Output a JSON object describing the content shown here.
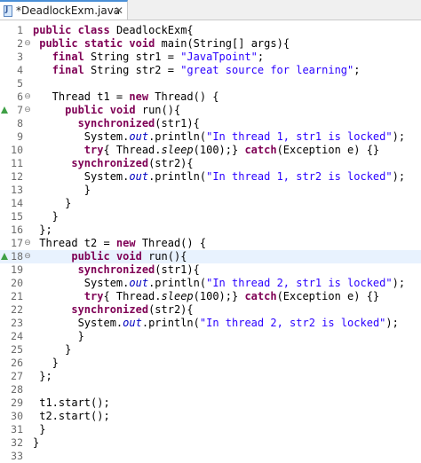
{
  "tab": {
    "title": "*DeadlockExm.java",
    "close_glyph": "✕"
  },
  "fold_glyphs": {
    "expanded": "⊖"
  },
  "lines": [
    {
      "n": "1",
      "segs": [
        {
          "t": "kw",
          "v": "public"
        },
        {
          "t": "p",
          "v": " "
        },
        {
          "t": "kw",
          "v": "class"
        },
        {
          "t": "p",
          "v": " DeadlockExm{"
        }
      ]
    },
    {
      "n": "2",
      "fold": true,
      "segs": [
        {
          "t": "p",
          "v": " "
        },
        {
          "t": "kw",
          "v": "public"
        },
        {
          "t": "p",
          "v": " "
        },
        {
          "t": "kw",
          "v": "static"
        },
        {
          "t": "p",
          "v": " "
        },
        {
          "t": "kw",
          "v": "void"
        },
        {
          "t": "p",
          "v": " main(String[] args){"
        }
      ]
    },
    {
      "n": "3",
      "segs": [
        {
          "t": "p",
          "v": "   "
        },
        {
          "t": "kw",
          "v": "final"
        },
        {
          "t": "p",
          "v": " String str1 = "
        },
        {
          "t": "str",
          "v": "\"JavaTpoint\""
        },
        {
          "t": "p",
          "v": ";"
        }
      ]
    },
    {
      "n": "4",
      "segs": [
        {
          "t": "p",
          "v": "   "
        },
        {
          "t": "kw",
          "v": "final"
        },
        {
          "t": "p",
          "v": " String str2 = "
        },
        {
          "t": "str",
          "v": "\"great source for learning\""
        },
        {
          "t": "p",
          "v": ";"
        }
      ]
    },
    {
      "n": "5",
      "segs": []
    },
    {
      "n": "6",
      "fold": true,
      "segs": [
        {
          "t": "p",
          "v": "   Thread t1 = "
        },
        {
          "t": "kw",
          "v": "new"
        },
        {
          "t": "p",
          "v": " Thread() {"
        }
      ]
    },
    {
      "n": "7",
      "fold": true,
      "marker": true,
      "segs": [
        {
          "t": "p",
          "v": "     "
        },
        {
          "t": "kw",
          "v": "public"
        },
        {
          "t": "p",
          "v": " "
        },
        {
          "t": "kw",
          "v": "void"
        },
        {
          "t": "p",
          "v": " run(){"
        }
      ]
    },
    {
      "n": "8",
      "segs": [
        {
          "t": "p",
          "v": "       "
        },
        {
          "t": "kw",
          "v": "synchronized"
        },
        {
          "t": "p",
          "v": "(str1){"
        }
      ]
    },
    {
      "n": "9",
      "segs": [
        {
          "t": "p",
          "v": "        System."
        },
        {
          "t": "fld",
          "v": "out"
        },
        {
          "t": "p",
          "v": ".println("
        },
        {
          "t": "str",
          "v": "\"In thread 1, str1 is locked\""
        },
        {
          "t": "p",
          "v": ");"
        }
      ]
    },
    {
      "n": "10",
      "segs": [
        {
          "t": "p",
          "v": "        "
        },
        {
          "t": "kw",
          "v": "try"
        },
        {
          "t": "p",
          "v": "{ Thread."
        },
        {
          "t": "it",
          "v": "sleep"
        },
        {
          "t": "p",
          "v": "(100);} "
        },
        {
          "t": "kw",
          "v": "catch"
        },
        {
          "t": "p",
          "v": "(Exception e) {}"
        }
      ]
    },
    {
      "n": "11",
      "segs": [
        {
          "t": "p",
          "v": "      "
        },
        {
          "t": "kw",
          "v": "synchronized"
        },
        {
          "t": "p",
          "v": "(str2){"
        }
      ]
    },
    {
      "n": "12",
      "segs": [
        {
          "t": "p",
          "v": "        System."
        },
        {
          "t": "fld",
          "v": "out"
        },
        {
          "t": "p",
          "v": ".println("
        },
        {
          "t": "str",
          "v": "\"In thread 1, str2 is locked\""
        },
        {
          "t": "p",
          "v": ");"
        }
      ]
    },
    {
      "n": "13",
      "segs": [
        {
          "t": "p",
          "v": "        }"
        }
      ]
    },
    {
      "n": "14",
      "segs": [
        {
          "t": "p",
          "v": "     }"
        }
      ]
    },
    {
      "n": "15",
      "segs": [
        {
          "t": "p",
          "v": "   }"
        }
      ]
    },
    {
      "n": "16",
      "segs": [
        {
          "t": "p",
          "v": " };"
        }
      ]
    },
    {
      "n": "17",
      "fold": true,
      "segs": [
        {
          "t": "p",
          "v": " Thread t2 = "
        },
        {
          "t": "kw",
          "v": "new"
        },
        {
          "t": "p",
          "v": " Thread() {"
        }
      ]
    },
    {
      "n": "18",
      "fold": true,
      "marker": true,
      "current": true,
      "segs": [
        {
          "t": "p",
          "v": "      "
        },
        {
          "t": "kw",
          "v": "public"
        },
        {
          "t": "p",
          "v": " "
        },
        {
          "t": "kw",
          "v": "void"
        },
        {
          "t": "p",
          "v": " run(){"
        }
      ]
    },
    {
      "n": "19",
      "segs": [
        {
          "t": "p",
          "v": "       "
        },
        {
          "t": "kw",
          "v": "synchronized"
        },
        {
          "t": "p",
          "v": "(str1){"
        }
      ]
    },
    {
      "n": "20",
      "segs": [
        {
          "t": "p",
          "v": "        System."
        },
        {
          "t": "fld",
          "v": "out"
        },
        {
          "t": "p",
          "v": ".println("
        },
        {
          "t": "str",
          "v": "\"In thread 2, str1 is locked\""
        },
        {
          "t": "p",
          "v": ");"
        }
      ]
    },
    {
      "n": "21",
      "segs": [
        {
          "t": "p",
          "v": "        "
        },
        {
          "t": "kw",
          "v": "try"
        },
        {
          "t": "p",
          "v": "{ Thread."
        },
        {
          "t": "it",
          "v": "sleep"
        },
        {
          "t": "p",
          "v": "(100);} "
        },
        {
          "t": "kw",
          "v": "catch"
        },
        {
          "t": "p",
          "v": "(Exception e) {}"
        }
      ]
    },
    {
      "n": "22",
      "segs": [
        {
          "t": "p",
          "v": "      "
        },
        {
          "t": "kw",
          "v": "synchronized"
        },
        {
          "t": "p",
          "v": "(str2){"
        }
      ]
    },
    {
      "n": "23",
      "segs": [
        {
          "t": "p",
          "v": "       System."
        },
        {
          "t": "fld",
          "v": "out"
        },
        {
          "t": "p",
          "v": ".println("
        },
        {
          "t": "str",
          "v": "\"In thread 2, str2 is locked\""
        },
        {
          "t": "p",
          "v": ");"
        }
      ]
    },
    {
      "n": "24",
      "segs": [
        {
          "t": "p",
          "v": "       }"
        }
      ]
    },
    {
      "n": "25",
      "segs": [
        {
          "t": "p",
          "v": "     }"
        }
      ]
    },
    {
      "n": "26",
      "segs": [
        {
          "t": "p",
          "v": "   }"
        }
      ]
    },
    {
      "n": "27",
      "segs": [
        {
          "t": "p",
          "v": " };"
        }
      ]
    },
    {
      "n": "28",
      "segs": []
    },
    {
      "n": "29",
      "segs": [
        {
          "t": "p",
          "v": " t1.start();"
        }
      ]
    },
    {
      "n": "30",
      "segs": [
        {
          "t": "p",
          "v": " t2.start();"
        }
      ]
    },
    {
      "n": "31",
      "segs": [
        {
          "t": "p",
          "v": " }"
        }
      ]
    },
    {
      "n": "32",
      "segs": [
        {
          "t": "p",
          "v": "}"
        }
      ]
    },
    {
      "n": "33",
      "segs": []
    }
  ]
}
